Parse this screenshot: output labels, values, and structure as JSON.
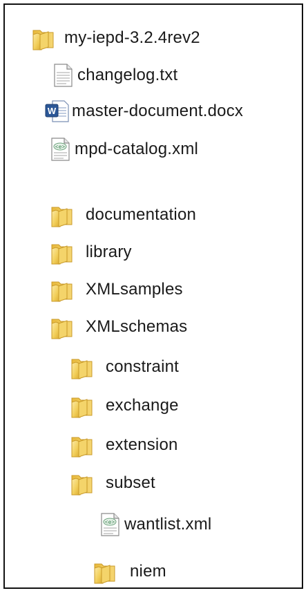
{
  "tree": {
    "root": {
      "label": "my-iepd-3.2.4rev2",
      "icon": "folder-icon"
    },
    "items": [
      {
        "label": "changelog.txt",
        "icon": "text-file-icon"
      },
      {
        "label": "master-document.docx",
        "icon": "word-document-icon"
      },
      {
        "label": "mpd-catalog.xml",
        "icon": "xml-file-icon"
      },
      {
        "label": "documentation",
        "icon": "folder-icon"
      },
      {
        "label": "library",
        "icon": "folder-icon"
      },
      {
        "label": "XMLsamples",
        "icon": "folder-icon"
      },
      {
        "label": "XMLschemas",
        "icon": "folder-icon"
      },
      {
        "label": "constraint",
        "icon": "folder-icon"
      },
      {
        "label": "exchange",
        "icon": "folder-icon"
      },
      {
        "label": "extension",
        "icon": "folder-icon"
      },
      {
        "label": "subset",
        "icon": "folder-icon"
      },
      {
        "label": "wantlist.xml",
        "icon": "xml-file-icon"
      },
      {
        "label": "niem",
        "icon": "folder-icon"
      }
    ]
  },
  "colors": {
    "folder_body": "#f2cf5b",
    "folder_dark": "#d9a92e",
    "folder_light": "#fbe9a6",
    "word_blue": "#2b5797"
  }
}
